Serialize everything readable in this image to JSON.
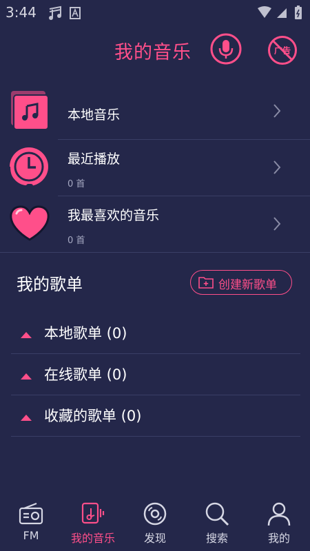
{
  "status_bar": {
    "time": "3:44"
  },
  "header": {
    "title": "我的音乐",
    "ad_label": "广告"
  },
  "quick": [
    {
      "title": "本地音乐",
      "subtitle": ""
    },
    {
      "title": "最近播放",
      "subtitle": "0 首"
    },
    {
      "title": "我最喜欢的音乐",
      "subtitle": "0 首"
    }
  ],
  "playlists": {
    "title": "我的歌单",
    "create_label": "创建新歌单",
    "groups": [
      {
        "label": "本地歌单 (0)"
      },
      {
        "label": "在线歌单 (0)"
      },
      {
        "label": "收藏的歌单 (0)"
      }
    ]
  },
  "nav": [
    {
      "label": "FM",
      "icon": "radio-icon"
    },
    {
      "label": "我的音乐",
      "icon": "music-note-icon"
    },
    {
      "label": "发现",
      "icon": "disc-icon"
    },
    {
      "label": "搜索",
      "icon": "search-icon"
    },
    {
      "label": "我的",
      "icon": "user-icon"
    }
  ],
  "colors": {
    "background": "#24274a",
    "accent": "#ff4f8a"
  }
}
